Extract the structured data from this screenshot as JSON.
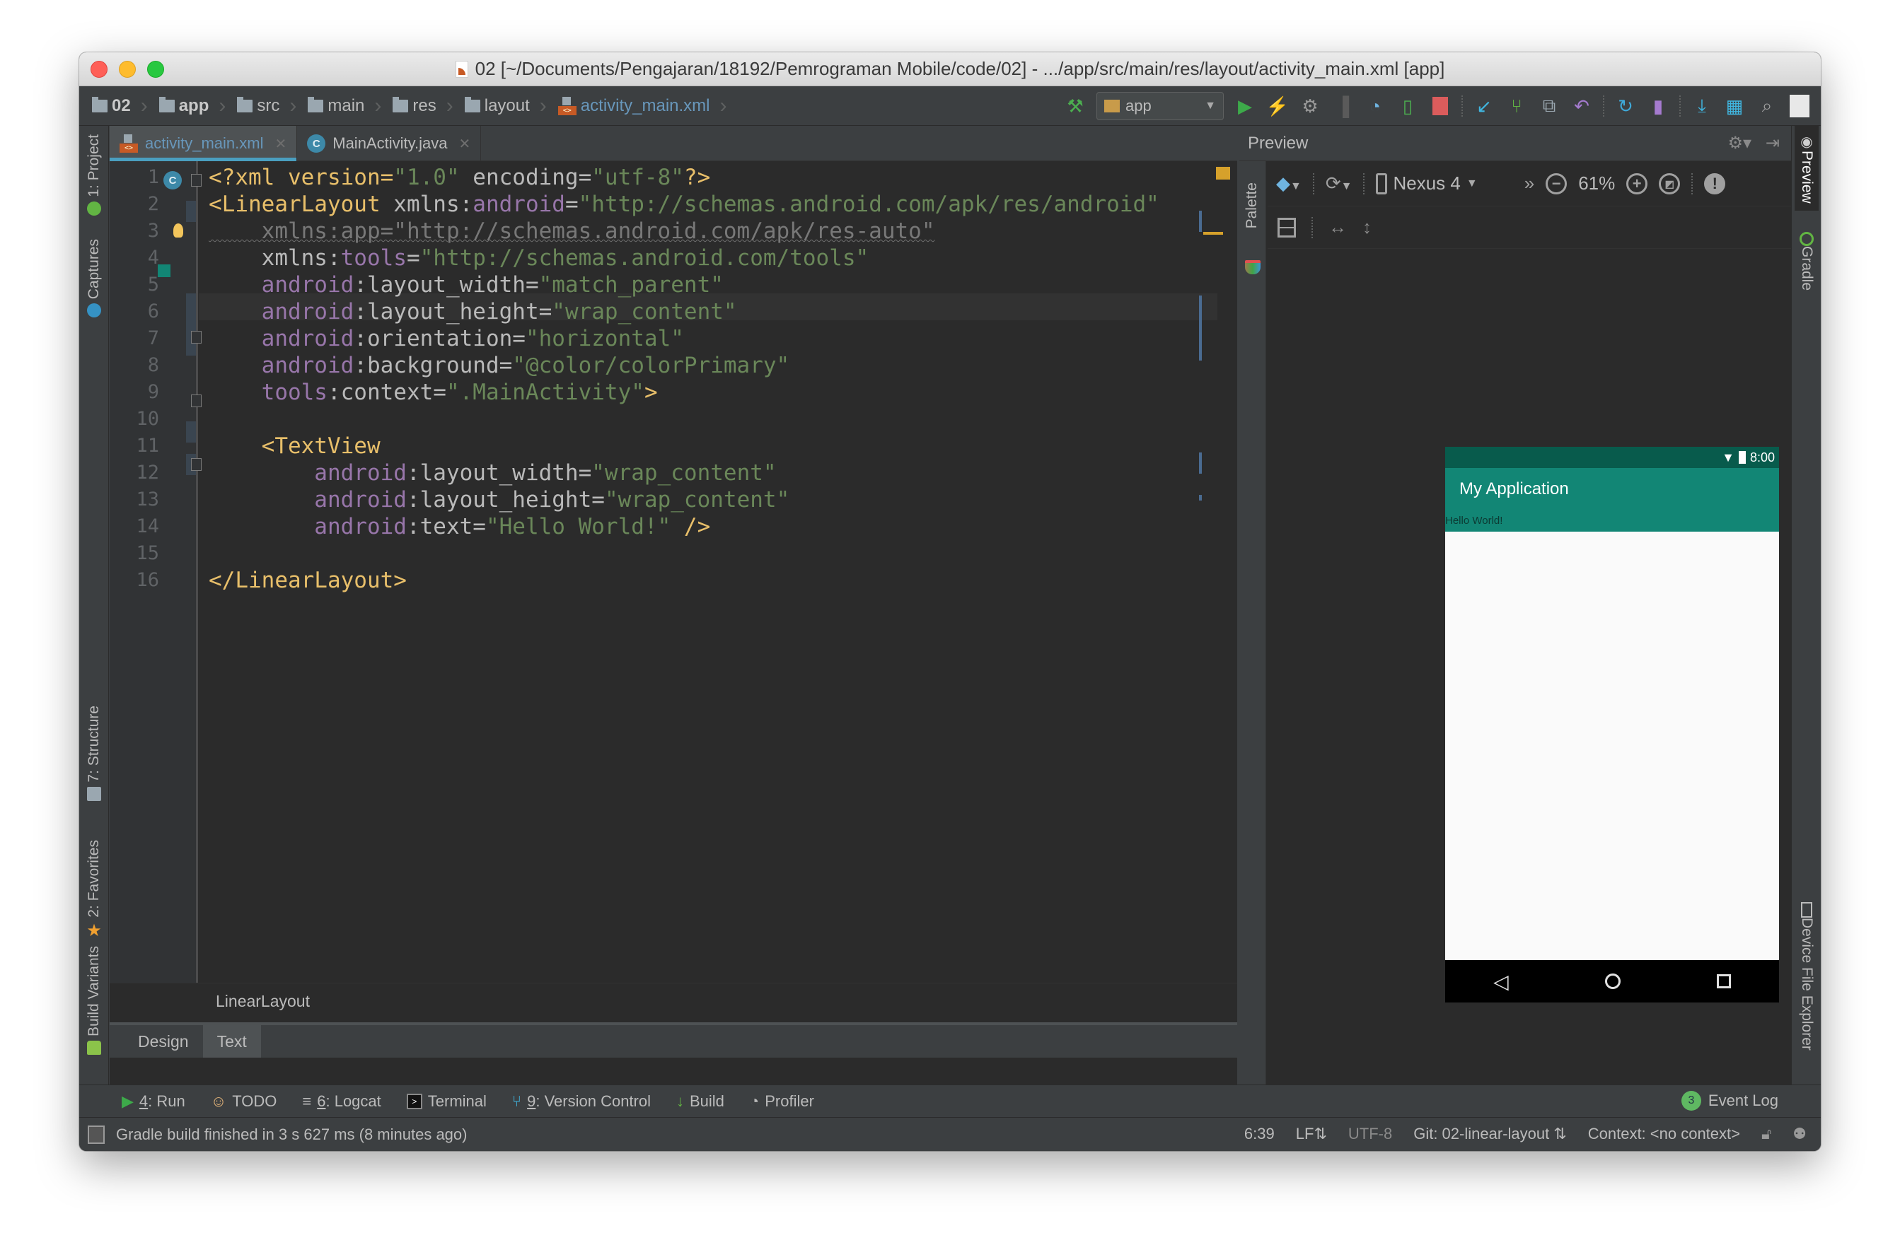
{
  "window": {
    "title": "02 [~/Documents/Pengajaran/18192/Pemrograman Mobile/code/02] - .../app/src/main/res/layout/activity_main.xml [app]"
  },
  "breadcrumbs": [
    {
      "label": "02",
      "icon": "project-folder-icon"
    },
    {
      "label": "app",
      "icon": "module-folder-icon"
    },
    {
      "label": "src",
      "icon": "folder-icon"
    },
    {
      "label": "main",
      "icon": "folder-icon"
    },
    {
      "label": "res",
      "icon": "res-folder-icon"
    },
    {
      "label": "layout",
      "icon": "folder-icon"
    },
    {
      "label": "activity_main.xml",
      "icon": "xml-file-icon"
    }
  ],
  "toolbar": {
    "run_config": "app",
    "icons": [
      "make-project-icon",
      "run-icon",
      "apply-changes-icon",
      "debug-icon",
      "attach-debugger-icon",
      "profile-icon",
      "run-android-debug-icon",
      "stop-icon",
      "vcs-update-icon",
      "vcs-commit-icon",
      "vcs-history-icon",
      "vcs-revert-icon",
      "sync-gradle-icon",
      "avd-manager-icon",
      "sdk-manager-icon",
      "project-structure-icon",
      "search-everywhere-icon",
      "user-avatar-icon"
    ]
  },
  "editor_tabs": [
    {
      "label": "activity_main.xml",
      "active": true
    },
    {
      "label": "MainActivity.java",
      "active": false
    }
  ],
  "code_lines": [
    "1",
    "2",
    "3",
    "4",
    "5",
    "6",
    "7",
    "8",
    "9",
    "10",
    "11",
    "12",
    "13",
    "14",
    "15",
    "16"
  ],
  "code": {
    "l1_a": "<?xml version=",
    "l1_b": "\"1.0\"",
    "l1_c": " encoding=",
    "l1_d": "\"utf-8\"",
    "l1_e": "?>",
    "l2_tag": "<LinearLayout",
    "l2_attr": " xmlns:",
    "l2_ns": "android",
    "l2_eq": "=",
    "l2_val": "\"http://schemas.android.com/apk/res/android\"",
    "l3": "    xmlns:app=\"http://schemas.android.com/apk/res-auto\"",
    "l4_attr": "    xmlns:",
    "l4_ns": "tools",
    "l4_eq": "=",
    "l4_val": "\"http://schemas.android.com/tools\"",
    "l5_ns": "    android",
    "l5_attr": ":layout_width=",
    "l5_val": "\"match_parent\"",
    "l6_ns": "    android",
    "l6_attr": ":layout_height=",
    "l6_val": "\"wrap_content\"",
    "l7_ns": "    android",
    "l7_attr": ":orientation=",
    "l7_val": "\"horizontal\"",
    "l8_ns": "    android",
    "l8_attr": ":background=",
    "l8_val": "\"@color/colorPrimary\"",
    "l9_ns": "    tools",
    "l9_attr": ":context=",
    "l9_val": "\".MainActivity\"",
    "l9_end": ">",
    "l11_tag": "    <TextView",
    "l12_ns": "        android",
    "l12_attr": ":layout_width=",
    "l12_val": "\"wrap_content\"",
    "l13_ns": "        android",
    "l13_attr": ":layout_height=",
    "l13_val": "\"wrap_content\"",
    "l14_ns": "        android",
    "l14_attr": ":text=",
    "l14_val": "\"Hello World!\"",
    "l14_end": " />",
    "l16_tag": "</LinearLayout>"
  },
  "editor_breadcrumb": "LinearLayout",
  "editor_bottom_tabs": [
    {
      "label": "Design",
      "active": false
    },
    {
      "label": "Text",
      "active": true
    }
  ],
  "left_strip": {
    "project": "1: Project",
    "captures": "Captures",
    "structure": "7: Structure",
    "favorites": "2: Favorites",
    "build_variants": "Build Variants"
  },
  "right_strip": {
    "preview": "Preview",
    "gradle": "Gradle",
    "device_file_explorer": "Device File Explorer"
  },
  "preview": {
    "title": "Preview",
    "palette": "Palette",
    "device": "Nexus 4",
    "zoom": "61%",
    "phone": {
      "status_time": "8:00",
      "app_title": "My Application",
      "hello_text": "Hello World!",
      "status_bar_color": "#085b4c",
      "primary_color": "#128675"
    }
  },
  "tool_windows": [
    {
      "key": "4",
      "label": ": Run",
      "icon": "run-icon"
    },
    {
      "key": "",
      "label": "TODO",
      "icon": "todo-icon"
    },
    {
      "key": "6",
      "label": ": Logcat",
      "icon": "logcat-icon"
    },
    {
      "key": "",
      "label": "Terminal",
      "icon": "terminal-icon"
    },
    {
      "key": "9",
      "label": ": Version Control",
      "icon": "version-control-icon"
    },
    {
      "key": "",
      "label": "Build",
      "icon": "build-icon"
    },
    {
      "key": "",
      "label": "Profiler",
      "icon": "profiler-icon"
    }
  ],
  "event_log": {
    "label": "Event Log",
    "count": "3"
  },
  "status_bar": {
    "message": "Gradle build finished in 3 s 627 ms (8 minutes ago)",
    "position": "6:39",
    "line_sep": "LF",
    "encoding": "UTF-8",
    "git_branch": "Git: 02-linear-layout",
    "context": "Context: <no context>"
  }
}
